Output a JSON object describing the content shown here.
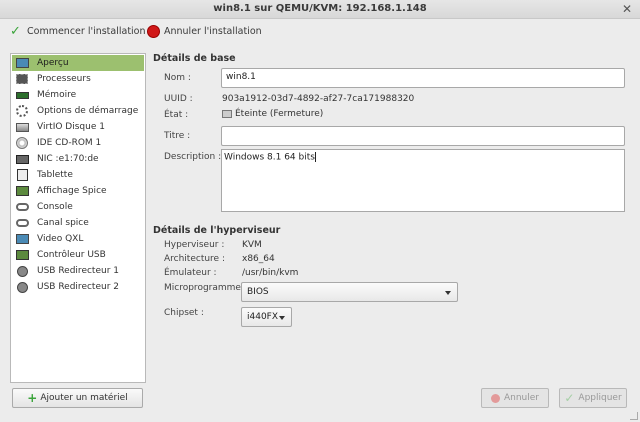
{
  "window": {
    "title": "win8.1 sur QEMU/KVM: 192.168.1.148"
  },
  "toolbar": {
    "start_label": "Commencer l'installation",
    "cancel_label": "Annuler l'installation"
  },
  "sidebar": {
    "items": [
      {
        "label": "Aperçu",
        "icon": "monitor-icon"
      },
      {
        "label": "Processeurs",
        "icon": "cpu-icon"
      },
      {
        "label": "Mémoire",
        "icon": "memory-icon"
      },
      {
        "label": "Options de démarrage",
        "icon": "boot-options-icon"
      },
      {
        "label": "VirtIO Disque 1",
        "icon": "disk-icon"
      },
      {
        "label": "IDE CD-ROM 1",
        "icon": "cdrom-icon"
      },
      {
        "label": "NIC :e1:70:de",
        "icon": "network-icon"
      },
      {
        "label": "Tablette",
        "icon": "tablet-icon"
      },
      {
        "label": "Affichage Spice",
        "icon": "display-icon"
      },
      {
        "label": "Console",
        "icon": "console-icon"
      },
      {
        "label": "Canal spice",
        "icon": "channel-icon"
      },
      {
        "label": "Video QXL",
        "icon": "video-icon"
      },
      {
        "label": "Contrôleur USB",
        "icon": "usb-controller-icon"
      },
      {
        "label": "USB Redirecteur 1",
        "icon": "usb-redirector-icon"
      },
      {
        "label": "USB Redirecteur 2",
        "icon": "usb-redirector-icon"
      }
    ],
    "selected": "Aperçu",
    "add_label": "Ajouter un matériel"
  },
  "basic": {
    "title": "Détails de base",
    "name_label": "Nom :",
    "name_value": "win8.1",
    "uuid_label": "UUID :",
    "uuid_value": "903a1912-03d7-4892-af27-7ca171988320",
    "state_label": "État :",
    "state_value": "Éteinte (Fermeture)",
    "titre_label": "Titre :",
    "titre_value": "",
    "desc_label": "Description :",
    "desc_value": "Windows 8.1 64 bits"
  },
  "hypervisor": {
    "title": "Détails de l'hyperviseur",
    "hv_label": "Hyperviseur :",
    "hv_value": "KVM",
    "arch_label": "Architecture :",
    "arch_value": "x86_64",
    "emu_label": "Émulateur :",
    "emu_value": "/usr/bin/kvm",
    "fw_label": "Microprogramme",
    "fw_value": "BIOS",
    "chipset_label": "Chipset :",
    "chipset_value": "i440FX"
  },
  "footer": {
    "cancel_label": "Annuler",
    "apply_label": "Appliquer"
  }
}
